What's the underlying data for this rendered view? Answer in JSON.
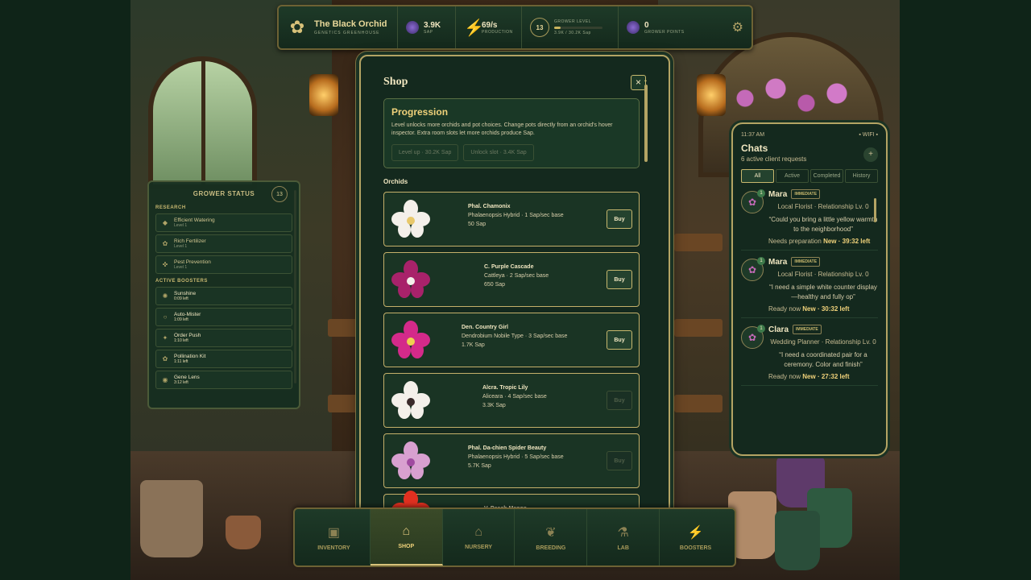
{
  "hud": {
    "brand_title": "The Black Orchid",
    "brand_sub": "GENETICS GREENHOUSE",
    "sap_value": "3.9K",
    "sap_label": "SAP",
    "production_value": "69/s",
    "production_label": "PRODUCTION",
    "grower_level": "13",
    "grower_level_label": "GROWER LEVEL",
    "xp_text": "3.9K / 30.2K Sap",
    "xp_fraction": 0.13,
    "grower_points_value": "0",
    "grower_points_label": "GROWER POINTS",
    "icons": {
      "brand": "orchid-icon",
      "sap": "sap-orb-icon",
      "production": "lightning-icon",
      "points": "points-orb-icon",
      "settings": "gear-icon"
    }
  },
  "grower_status": {
    "title": "GROWER STATUS",
    "level": "13",
    "research_label": "RESEARCH",
    "research": [
      {
        "name": "Efficient Watering",
        "sub": "Level 1",
        "icon": "droplet-icon"
      },
      {
        "name": "Rich Fertilizer",
        "sub": "Level 1",
        "icon": "leaf-icon"
      },
      {
        "name": "Pest Prevention",
        "sub": "Level 1",
        "icon": "shield-icon"
      }
    ],
    "boosters_label": "ACTIVE BOOSTERS",
    "boosters": [
      {
        "name": "Sunshine",
        "sub": "0:09 left",
        "icon": "sun-icon"
      },
      {
        "name": "Auto-Mister",
        "sub": "1:09 left",
        "icon": "mist-icon"
      },
      {
        "name": "Order Push",
        "sub": "1:10 left",
        "icon": "star-icon"
      },
      {
        "name": "Pollination Kit",
        "sub": "1:11 left",
        "icon": "flower-icon"
      },
      {
        "name": "Gene Lens",
        "sub": "3:12 left",
        "icon": "lens-icon"
      }
    ]
  },
  "shop": {
    "title": "Shop",
    "close_label": "×",
    "progression": {
      "title": "Progression",
      "text": "Level unlocks more orchids and pot choices. Change pots directly from an orchid's hover inspector. Extra room slots let more orchids produce Sap.",
      "level_up": "Level up · 30.2K Sap",
      "unlock_slot": "Unlock slot · 3.4K Sap"
    },
    "orchids_label": "Orchids",
    "orchids": [
      {
        "name": "Phal. Chamonix",
        "type": "Phalaenopsis Hybrid · 1 Sap/sec base",
        "price": "50 Sap",
        "buy": "Buy",
        "enabled": true,
        "color": "#f4f0ea",
        "accent": "#e8c86a"
      },
      {
        "name": "C. Purple Cascade",
        "type": "Cattleya · 2 Sap/sec base",
        "price": "650 Sap",
        "buy": "Buy",
        "enabled": true,
        "color": "#a8226a",
        "accent": "#f4f0ea"
      },
      {
        "name": "Den. Country Girl",
        "type": "Dendrobium Nobile Type · 3 Sap/sec base",
        "price": "1.7K Sap",
        "buy": "Buy",
        "enabled": true,
        "color": "#d42a8a",
        "accent": "#f0d050"
      },
      {
        "name": "Alcra. Tropic Lily",
        "type": "Aliceara · 4 Sap/sec base",
        "price": "3.3K Sap",
        "buy": "Buy",
        "enabled": false,
        "color": "#f4f0ea",
        "accent": "#3a2a2a"
      },
      {
        "name": "Phal. Da-chien Spider Beauty",
        "type": "Phalaenopsis Hybrid · 5 Sap/sec base",
        "price": "5.7K Sap",
        "buy": "Buy",
        "enabled": false,
        "color": "#d8a0d0",
        "accent": "#a04aa0"
      },
      {
        "name": "V. Peach Mango",
        "type": "",
        "price": "",
        "buy": "",
        "enabled": false,
        "color": "#e03020",
        "accent": "#e03020"
      }
    ]
  },
  "chats": {
    "time": "11:37 AM",
    "wifi": "▪ WIFI ▪",
    "title": "Chats",
    "subtitle": "6 active client requests",
    "plus": "+",
    "tabs": [
      "All",
      "Active",
      "Completed",
      "History"
    ],
    "items": [
      {
        "name": "Mara",
        "badge": "IMMEDIATE",
        "count": "1",
        "role": "Local Florist · Relationship Lv. 0",
        "quote": "“Could you bring a little yellow warmth to the neighborhood”",
        "status": "Needs preparation",
        "timer": "New · 39:32 left",
        "icon": "orchid-icon"
      },
      {
        "name": "Mara",
        "badge": "IMMEDIATE",
        "count": "1",
        "role": "Local Florist · Relationship Lv. 0",
        "quote": "“I need a simple white counter display—healthy and fully op”",
        "status": "Ready now",
        "timer": "New · 30:32 left",
        "icon": "orchid-icon"
      },
      {
        "name": "Clara",
        "badge": "IMMEDIATE",
        "count": "1",
        "role": "Wedding Planner · Relationship Lv. 0",
        "quote": "“I need a coordinated pair for a ceremony. Color and finish”",
        "status": "Ready now",
        "timer": "New · 27:32 left",
        "icon": "orchid-icon"
      }
    ]
  },
  "nav": [
    {
      "label": "INVENTORY",
      "icon": "chest-icon",
      "active": false
    },
    {
      "label": "SHOP",
      "icon": "shop-icon",
      "active": true
    },
    {
      "label": "NURSERY",
      "icon": "nursery-icon",
      "active": false
    },
    {
      "label": "BREEDING",
      "icon": "sprout-icon",
      "active": false
    },
    {
      "label": "LAB",
      "icon": "flask-icon",
      "active": false
    },
    {
      "label": "BOOSTERS",
      "icon": "lightning-icon",
      "active": false
    }
  ]
}
